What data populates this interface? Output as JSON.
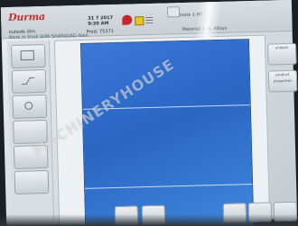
{
  "header": {
    "logo_text": "Durma",
    "line1": "outside dim.",
    "line2": "Work in    Snell   SHM SHARADAD   Nain",
    "date": "31 7 2017",
    "time": "9:30 AM",
    "product": "Prod: 75371",
    "product2": "Material 1: A. Alloys",
    "top_right_1": "Tonnelate 1 HT",
    "top_right_2": "",
    "top_right_3": ""
  },
  "right_panel": {
    "button_1": "undock",
    "button_2": "product properties"
  },
  "watermark": {
    "text": "MACHINERYHOUSE"
  },
  "colors": {
    "blue_panel": "#2f6fd0",
    "logo": "#c0322b",
    "status_red": "#c7272c",
    "status_yellow": "#e8c62a"
  },
  "icons": [
    "alert-icon",
    "warning-icon",
    "grid-icon"
  ]
}
